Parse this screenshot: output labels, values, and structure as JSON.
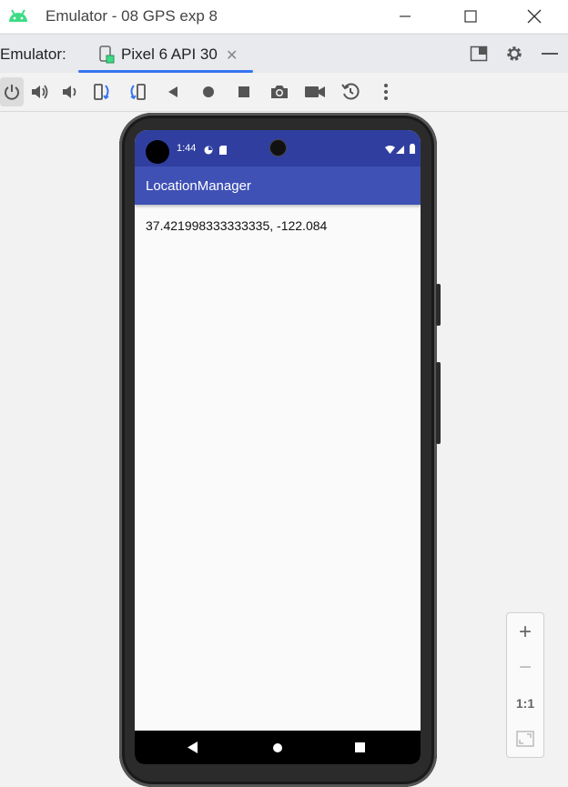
{
  "window": {
    "title": "Emulator - 08 GPS exp 8"
  },
  "tabstrip": {
    "label": "Emulator:",
    "tab_title": "Pixel 6 API 30",
    "tab_close": "✕"
  },
  "toolbar": {
    "icons": [
      "power-icon",
      "volume-up-icon",
      "volume-down-icon",
      "rotate-left-icon",
      "rotate-right-icon",
      "back-icon",
      "home-icon",
      "overview-icon",
      "camera-icon",
      "record-icon",
      "snapshot-icon",
      "more-icon"
    ]
  },
  "device": {
    "status_time": "1:44",
    "app_title": "LocationManager",
    "location_text": "37.421998333333335, -122.084"
  },
  "zoom": {
    "zoom_in": "+",
    "zoom_out": "−",
    "actual_size": "1:1"
  },
  "colors": {
    "status_bar": "#303f9f",
    "app_bar": "#3f51b5",
    "tab_accent": "#3574f0",
    "android_green": "#3ddc84"
  }
}
